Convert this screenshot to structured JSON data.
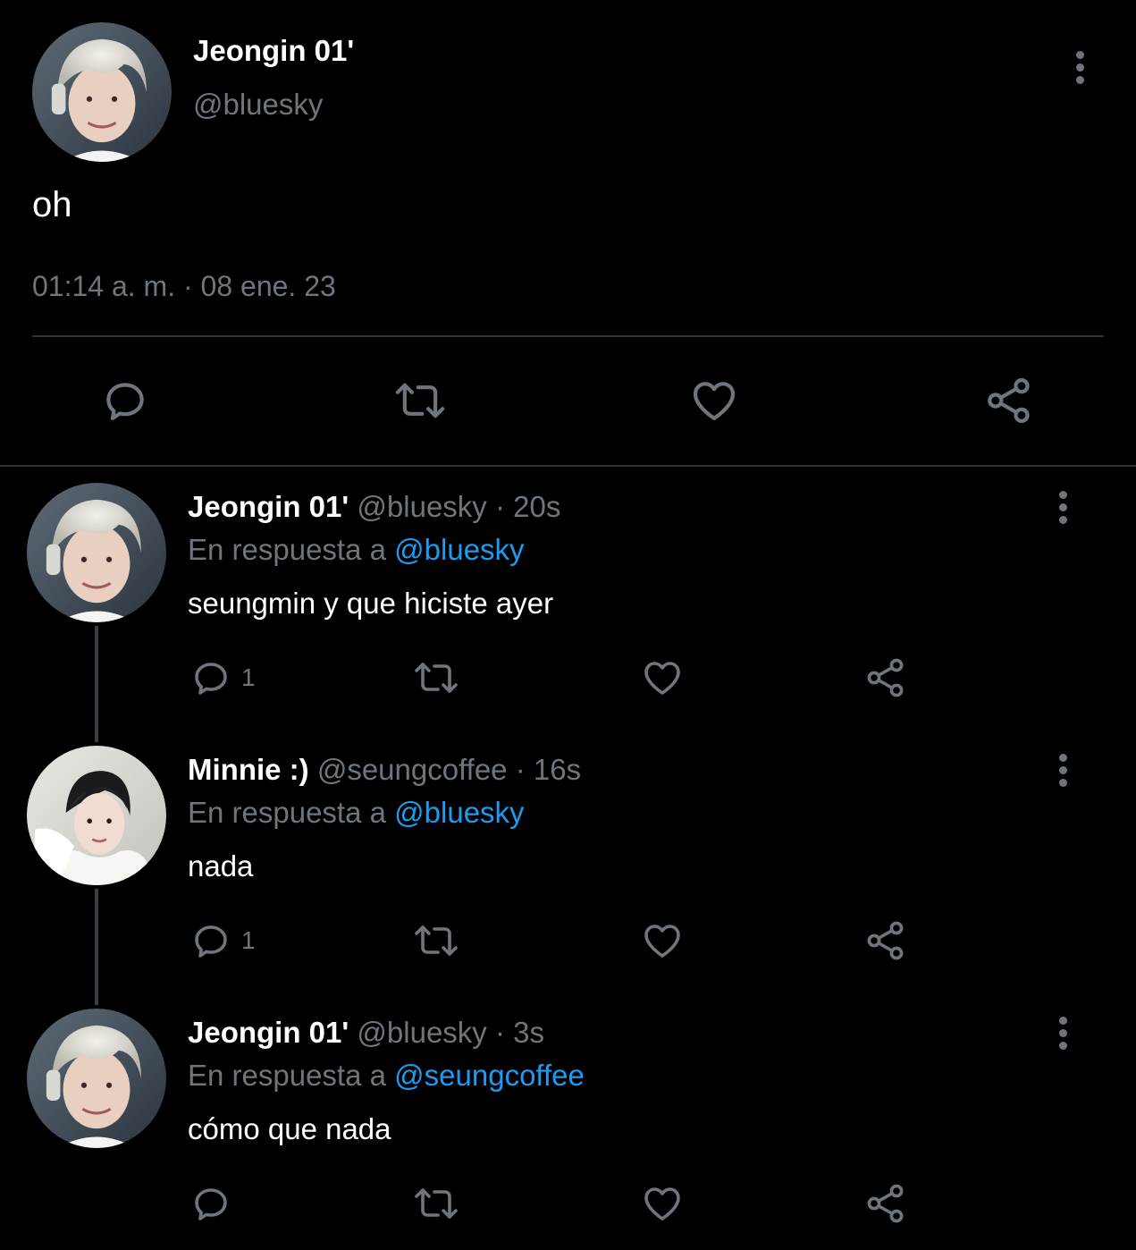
{
  "colors": {
    "background": "#000000",
    "text": "#ffffff",
    "muted": "#6e767d",
    "link": "#1d9bf0",
    "divider": "#2f3336"
  },
  "main_tweet": {
    "display_name": "Jeongin 01'",
    "handle": "@bluesky",
    "text": "oh",
    "timestamp": "01:14 a. m. · 08 ene. 23",
    "actions": [
      "reply-icon",
      "retweet-icon",
      "like-icon",
      "share-icon"
    ]
  },
  "replies": [
    {
      "display_name": "Jeongin 01'",
      "handle": "@bluesky",
      "time": "· 20s",
      "reply_prefix": "En respuesta a",
      "reply_to": "@bluesky",
      "text": "seungmin y que hiciste ayer",
      "reply_count": "1"
    },
    {
      "display_name": "Minnie :)",
      "handle": "@seungcoffee",
      "time": "· 16s",
      "reply_prefix": "En respuesta a",
      "reply_to": "@bluesky",
      "text": "nada",
      "reply_count": "1"
    },
    {
      "display_name": "Jeongin 01'",
      "handle": "@bluesky",
      "time": "· 3s",
      "reply_prefix": "En respuesta a",
      "reply_to": "@seungcoffee",
      "text": "cómo que nada",
      "reply_count": ""
    }
  ]
}
